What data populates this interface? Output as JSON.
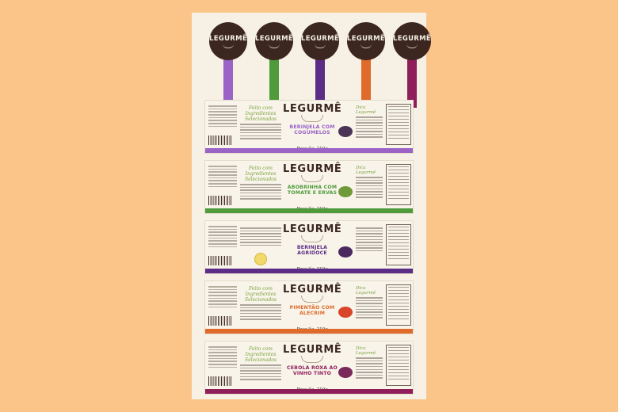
{
  "brand": "LEGURMÊ",
  "colors": {
    "background": "#fbc58a",
    "sheet": "#f6f1e4",
    "brand_brown": "#3b2620",
    "purple_light": "#9b63c6",
    "green": "#4f9a3a",
    "purple_dark": "#5c2d86",
    "orange": "#e06a2a",
    "magenta": "#8f1f5b"
  },
  "tags": [
    {
      "brand": "LEGURMÊ",
      "color": "#9b63c6"
    },
    {
      "brand": "LEGURMÊ",
      "color": "#4f9a3a"
    },
    {
      "brand": "LEGURMÊ",
      "color": "#5c2d86"
    },
    {
      "brand": "LEGURMÊ",
      "color": "#e06a2a"
    },
    {
      "brand": "LEGURMÊ",
      "color": "#8f1f5b"
    }
  ],
  "labels": [
    {
      "brand": "LEGURMÊ",
      "product": "BERINJELA COM COGUMELOS",
      "script": "Feito com Ingredientes Selecionados",
      "desc_title": "Dica Legurmê",
      "color": "#9b63c6",
      "veg_color": "#4a3458",
      "weight": "Peso líq. 210g"
    },
    {
      "brand": "LEGURMÊ",
      "product": "ABOBRINHA COM TOMATE E ERVAS",
      "script": "Feito com Ingredientes Selecionados",
      "desc_title": "Dica Legurmê",
      "color": "#4f9a3a",
      "veg_color": "#6f9a3a",
      "weight": "Peso líq. 210g"
    },
    {
      "brand": "LEGURMÊ",
      "product": "BERINJELA AGRIDOCE",
      "script": "",
      "desc_title": "",
      "color": "#5c2d86",
      "veg_color": "#4a2a5e",
      "weight": "Peso líq. 210g"
    },
    {
      "brand": "LEGURMÊ",
      "product": "PIMENTÃO COM ALECRIM",
      "script": "Feito com Ingredientes Selecionados",
      "desc_title": "Dica Legurmê",
      "color": "#e06a2a",
      "veg_color": "#d9452a",
      "weight": "Peso líq. 210g"
    },
    {
      "brand": "LEGURMÊ",
      "product": "CEBOLA ROXA AO VINHO TINTO",
      "script": "Feito com Ingredientes Selecionados",
      "desc_title": "Dica Legurmê",
      "color": "#8f1f5b",
      "veg_color": "#7a2a5a",
      "weight": "Peso líq. 210g"
    }
  ]
}
